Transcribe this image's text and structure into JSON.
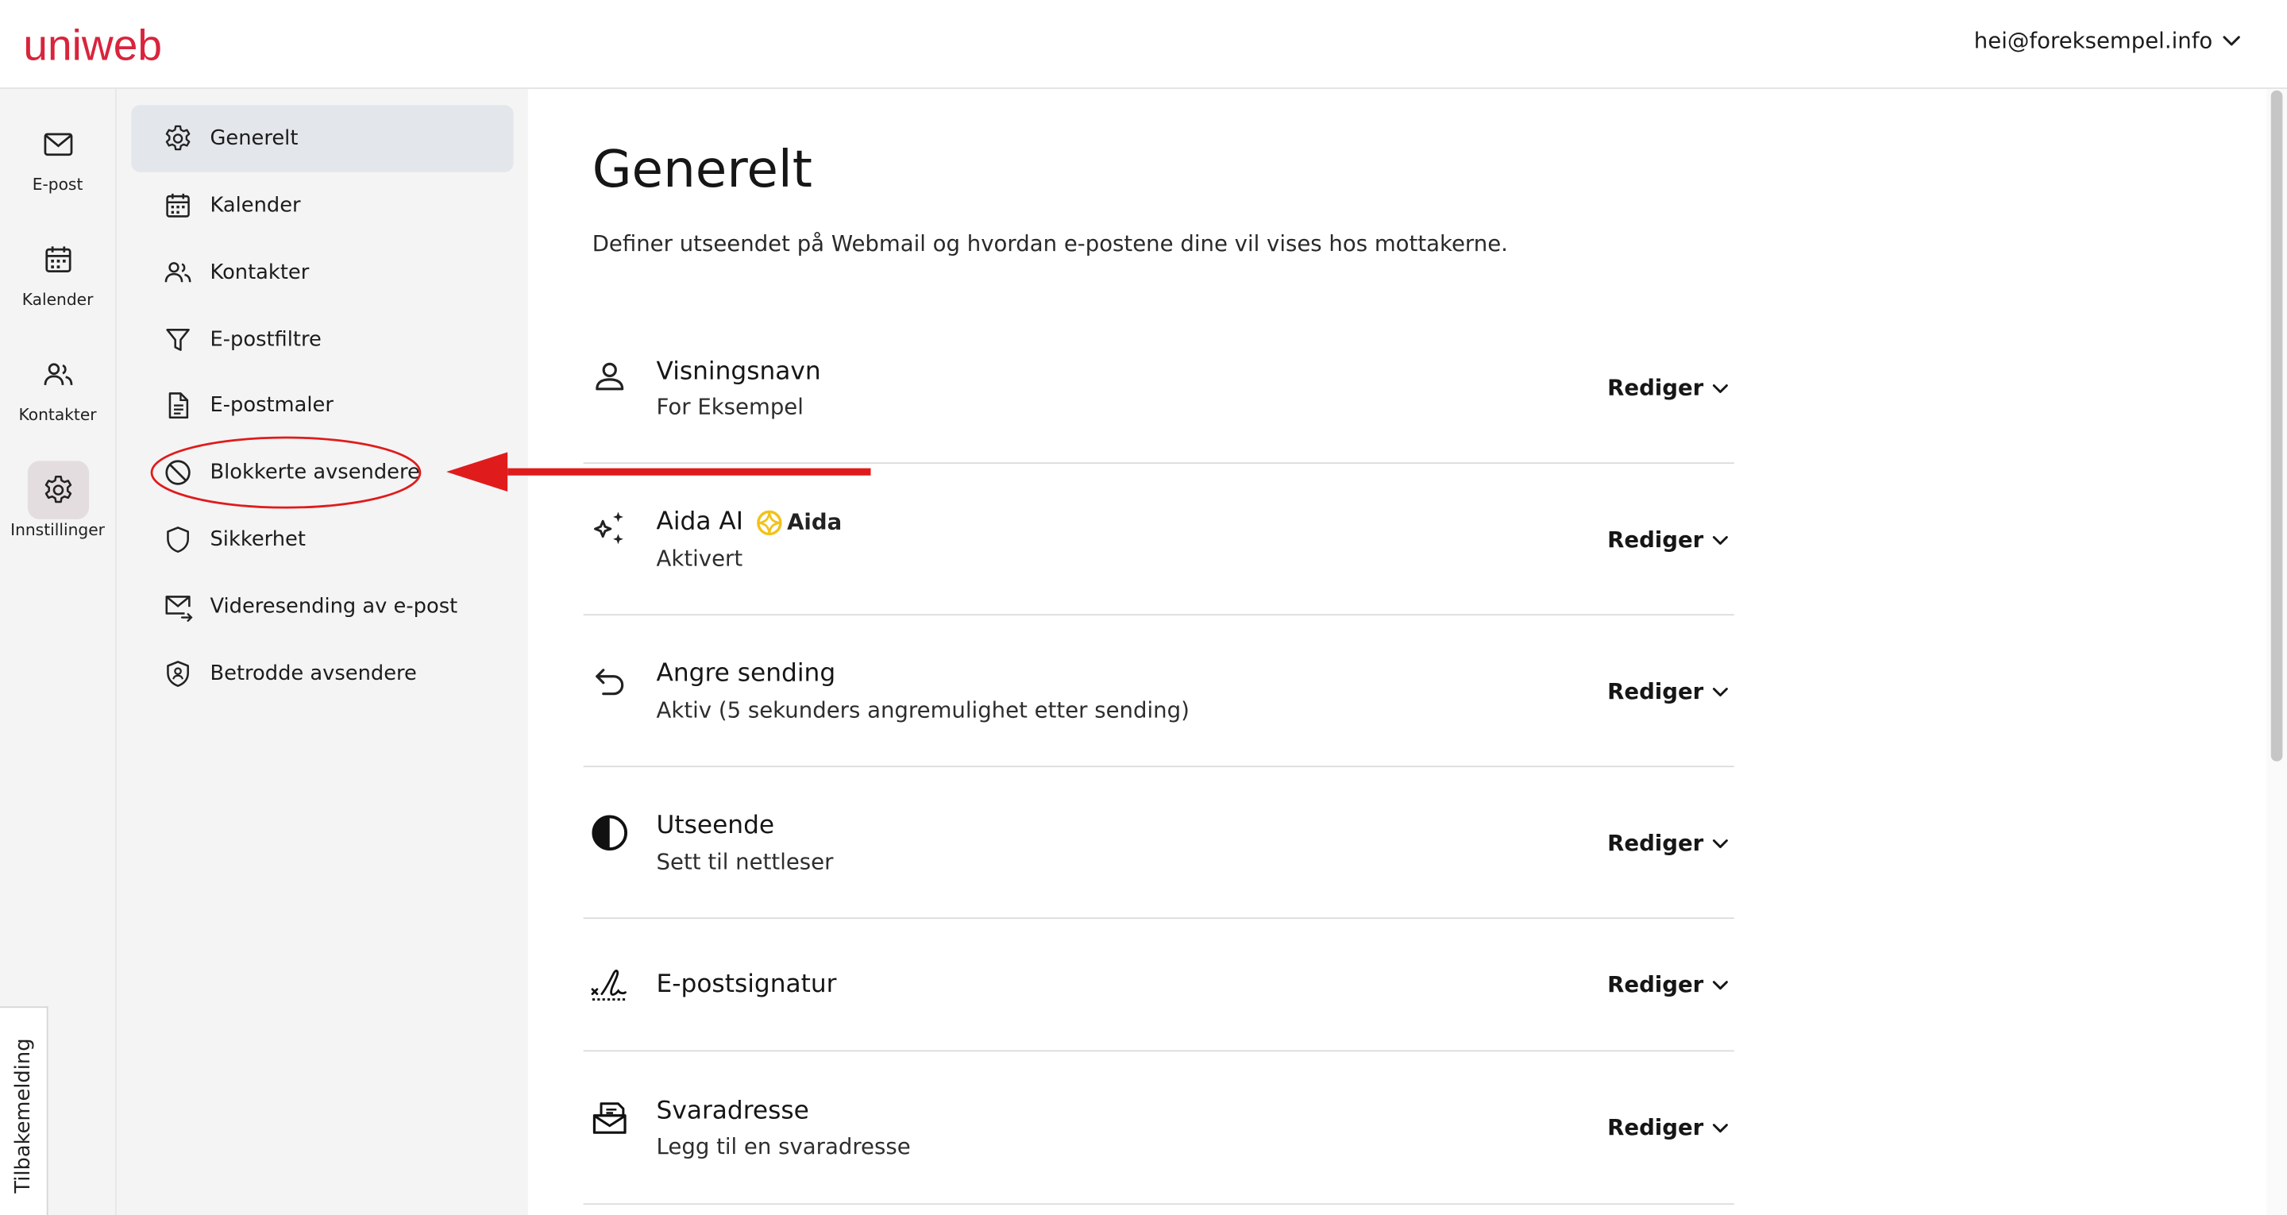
{
  "header": {
    "logo_text": "uniweb",
    "account_email": "hei@foreksempel.info"
  },
  "rail": {
    "items": [
      {
        "label": "E-post",
        "icon": "mail-icon"
      },
      {
        "label": "Kalender",
        "icon": "calendar-icon"
      },
      {
        "label": "Kontakter",
        "icon": "contacts-icon"
      },
      {
        "label": "Innstillinger",
        "icon": "gear-icon",
        "active": true
      }
    ],
    "feedback_label": "Tilbakemelding"
  },
  "submenu": {
    "items": [
      {
        "label": "Generelt",
        "icon": "gear-icon",
        "active": true
      },
      {
        "label": "Kalender",
        "icon": "calendar-icon"
      },
      {
        "label": "Kontakter",
        "icon": "contacts-icon"
      },
      {
        "label": "E-postfiltre",
        "icon": "filter-icon"
      },
      {
        "label": "E-postmaler",
        "icon": "document-icon"
      },
      {
        "label": "Blokkerte avsendere",
        "icon": "block-icon",
        "highlighted": true
      },
      {
        "label": "Sikkerhet",
        "icon": "shield-icon"
      },
      {
        "label": "Videresending av e-post",
        "icon": "forward-mail-icon"
      },
      {
        "label": "Betrodde avsendere",
        "icon": "trusted-shield-icon"
      }
    ]
  },
  "main": {
    "title": "Generelt",
    "description": "Definer utseendet på Webmail og hvordan e-postene dine vil vises hos mottakerne.",
    "edit_label": "Rediger",
    "aida_badge": "Aida",
    "settings": [
      {
        "title": "Visningsnavn",
        "subtitle": "For Eksempel",
        "icon": "person-icon"
      },
      {
        "title": "Aida AI",
        "subtitle": "Aktivert",
        "icon": "sparkle-icon"
      },
      {
        "title": "Angre sending",
        "subtitle": "Aktiv (5 sekunders angremulighet etter sending)",
        "icon": "undo-icon"
      },
      {
        "title": "Utseende",
        "subtitle": "Sett til nettleser",
        "icon": "contrast-icon"
      },
      {
        "title": "E-postsignatur",
        "subtitle": "",
        "icon": "signature-icon"
      },
      {
        "title": "Svaradresse",
        "subtitle": "Legg til en svaradresse",
        "icon": "reply-mailbox-icon"
      }
    ]
  },
  "colors": {
    "brand": "#d8243c",
    "annotation_red": "#e01b1b",
    "aida_yellow": "#f2c21b",
    "active_bg": "#e3e6ea"
  }
}
